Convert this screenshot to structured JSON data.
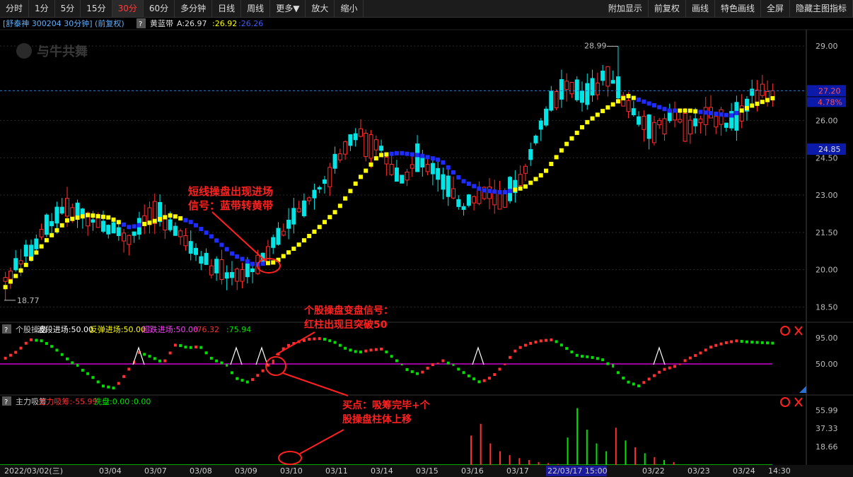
{
  "toolbar": {
    "left": [
      "分时",
      "1分",
      "5分",
      "15分",
      "30分",
      "60分",
      "多分钟",
      "日线",
      "周线",
      "更多▼",
      "放大",
      "缩小"
    ],
    "active": "30分",
    "right": [
      "附加显示",
      "前复权",
      "画线",
      "特色画线",
      "全屏",
      "隐藏主图指标"
    ]
  },
  "header": {
    "stock": "[舒泰神 300204 30分钟] (前复权)",
    "q": "?",
    "indicator": "黄蓝带",
    "a_label": "A:26.97",
    "v1": ":26.92",
    "v2": ":26.26"
  },
  "watermark": "与牛共舞",
  "colors": {
    "up": "#ff3030",
    "down": "#00e5e5",
    "yellow": "#ffff00",
    "blue": "#1e2cff",
    "grid": "#2a2a2a",
    "magenta": "#d000d0",
    "green": "#00e000",
    "annot": "#ff2020"
  },
  "price_axis": {
    "min": 18.0,
    "max": 29.6,
    "ticks": [
      "29.00",
      "26.00",
      "24.50",
      "23.00",
      "21.50",
      "20.00",
      "18.50"
    ]
  },
  "price_tags": {
    "last": "27.20",
    "pct": "4.78%",
    "ref": "24.85",
    "high": "28.99",
    "low": "18.77"
  },
  "chart_data": [
    {
      "type": "candlestick",
      "title": "舒泰神 300204 30分钟",
      "x_labels": [
        "2022/03/02(三)",
        "03/04",
        "03/07",
        "03/08",
        "03/09",
        "03/10",
        "03/11",
        "03/14",
        "03/15",
        "03/16",
        "03/17",
        "22/03/17 15:00",
        "03/22",
        "03/23",
        "03/24",
        "14:30"
      ],
      "ohlc_sampled": [
        [
          19.0,
          19.9,
          18.77,
          19.6
        ],
        [
          19.6,
          20.9,
          19.4,
          20.6
        ],
        [
          20.6,
          22.3,
          20.4,
          21.7
        ],
        [
          21.7,
          23.3,
          21.5,
          22.6
        ],
        [
          22.6,
          23.0,
          21.8,
          22.1
        ],
        [
          22.1,
          22.5,
          21.0,
          21.6
        ],
        [
          21.6,
          22.0,
          20.8,
          21.2
        ],
        [
          21.2,
          22.9,
          21.0,
          22.4
        ],
        [
          22.4,
          22.8,
          21.4,
          21.8
        ],
        [
          21.8,
          21.9,
          20.2,
          20.8
        ],
        [
          20.8,
          21.2,
          19.6,
          20.1
        ],
        [
          20.1,
          20.6,
          19.4,
          19.7
        ],
        [
          19.7,
          20.2,
          19.2,
          20.0
        ],
        [
          20.0,
          21.5,
          19.8,
          21.1
        ],
        [
          21.1,
          22.6,
          21.0,
          22.2
        ],
        [
          22.2,
          23.6,
          22.0,
          23.1
        ],
        [
          23.1,
          24.7,
          22.9,
          24.3
        ],
        [
          24.3,
          26.5,
          24.0,
          25.6
        ],
        [
          25.6,
          26.6,
          24.5,
          25.0
        ],
        [
          25.0,
          25.4,
          23.0,
          23.6
        ],
        [
          23.6,
          24.6,
          23.2,
          24.4
        ],
        [
          24.4,
          24.8,
          23.3,
          23.7
        ],
        [
          23.7,
          24.0,
          21.6,
          22.4
        ],
        [
          22.4,
          23.4,
          22.0,
          23.1
        ],
        [
          23.1,
          23.6,
          21.8,
          22.8
        ],
        [
          22.8,
          24.6,
          22.5,
          24.0
        ],
        [
          24.0,
          26.2,
          23.8,
          26.0
        ],
        [
          26.0,
          27.8,
          25.6,
          27.4
        ],
        [
          27.4,
          27.9,
          26.1,
          26.8
        ],
        [
          26.8,
          28.99,
          26.4,
          27.9
        ],
        [
          27.9,
          28.1,
          26.3,
          26.6
        ],
        [
          26.6,
          27.0,
          25.3,
          25.6
        ],
        [
          25.6,
          26.5,
          25.3,
          26.2
        ],
        [
          26.2,
          26.9,
          25.5,
          25.8
        ],
        [
          25.8,
          26.6,
          25.4,
          26.3
        ],
        [
          26.3,
          26.6,
          25.4,
          25.7
        ],
        [
          25.7,
          27.6,
          25.5,
          27.2
        ],
        [
          27.2,
          27.4,
          26.7,
          26.97
        ]
      ],
      "yellow_blue_band_sampled": [
        [
          19.3,
          "y"
        ],
        [
          20.2,
          "y"
        ],
        [
          21.2,
          "y"
        ],
        [
          22.0,
          "y"
        ],
        [
          22.2,
          "y"
        ],
        [
          22.1,
          "y"
        ],
        [
          21.7,
          "b"
        ],
        [
          21.9,
          "y"
        ],
        [
          22.2,
          "y"
        ],
        [
          21.9,
          "b"
        ],
        [
          21.3,
          "b"
        ],
        [
          20.6,
          "b"
        ],
        [
          20.2,
          "b"
        ],
        [
          20.3,
          "y"
        ],
        [
          20.9,
          "y"
        ],
        [
          21.6,
          "y"
        ],
        [
          22.4,
          "y"
        ],
        [
          23.6,
          "y"
        ],
        [
          24.6,
          "y"
        ],
        [
          24.7,
          "b"
        ],
        [
          24.6,
          "b"
        ],
        [
          24.4,
          "b"
        ],
        [
          23.6,
          "b"
        ],
        [
          23.2,
          "b"
        ],
        [
          23.1,
          "b"
        ],
        [
          23.3,
          "y"
        ],
        [
          23.9,
          "y"
        ],
        [
          25.0,
          "y"
        ],
        [
          25.9,
          "y"
        ],
        [
          26.5,
          "y"
        ],
        [
          27.0,
          "y"
        ],
        [
          26.7,
          "b"
        ],
        [
          26.4,
          "b"
        ],
        [
          26.4,
          "y"
        ],
        [
          26.3,
          "b"
        ],
        [
          26.2,
          "b"
        ],
        [
          26.6,
          "y"
        ],
        [
          26.9,
          "y"
        ]
      ]
    },
    {
      "type": "oscillator",
      "title": "个股操盘",
      "legend": [
        {
          "text": "个股操盘",
          "color": "#cccccc"
        },
        {
          "text": "波段进场:50.00",
          "color": "#ffffff"
        },
        {
          "text": "反弹进场:50.00",
          "color": "#ffff00"
        },
        {
          "text": "超跌进场:50.00",
          "color": "#ff40ff"
        },
        {
          "text": ":76.32",
          "color": "#ff3030"
        },
        {
          "text": ":75.94",
          "color": "#00e000"
        }
      ],
      "axis_ticks": [
        "95.00",
        "50.00"
      ],
      "ylim": [
        0,
        105
      ],
      "values_sampled": [
        60,
        72,
        92,
        90,
        78,
        60,
        44,
        30,
        12,
        8,
        36,
        70,
        62,
        52,
        84,
        78,
        80,
        58,
        50,
        25,
        18,
        35,
        58,
        80,
        88,
        93,
        94,
        88,
        76,
        70,
        74,
        76,
        58,
        40,
        32,
        48,
        56,
        44,
        30,
        18,
        28,
        50,
        76,
        85,
        90,
        92,
        78,
        64,
        62,
        58,
        42,
        20,
        12,
        26,
        40,
        46,
        58,
        68,
        80,
        86,
        90,
        88,
        87,
        86
      ]
    },
    {
      "type": "bar",
      "title": "主力吸筹",
      "legend": [
        {
          "text": "主力吸筹",
          "color": "#cccccc"
        },
        {
          "text": "主力吸筹:-55.99",
          "color": "#ff3030"
        },
        {
          "text": "洗盘:0.00",
          "color": "#00e000"
        },
        {
          "text": ":0.00",
          "color": "#00e000"
        }
      ],
      "axis_ticks": [
        "55.99",
        "37.33",
        "18.66"
      ],
      "ylim": [
        0,
        62
      ],
      "values_sampled": [
        0,
        0,
        0,
        0,
        0,
        0,
        0,
        0,
        0,
        0,
        0,
        0,
        0,
        0,
        0,
        0,
        0,
        0,
        0,
        0,
        0,
        0,
        0,
        0,
        0,
        0,
        0,
        0,
        0,
        0,
        0,
        0,
        0,
        0,
        0,
        0,
        0,
        0,
        0,
        0,
        0,
        0,
        0,
        0,
        0,
        0,
        0,
        0,
        30,
        42,
        22,
        14,
        10,
        7,
        5,
        3,
        2,
        1,
        28,
        58,
        36,
        22,
        14,
        38,
        25,
        18,
        12,
        8,
        5,
        3,
        0,
        0,
        0,
        0,
        0,
        0,
        0,
        0,
        0,
        0
      ]
    }
  ],
  "annotations": {
    "a1": [
      "短线操盘出现进场",
      "信号：蓝带转黄带"
    ],
    "a2": [
      "个股操盘变盘信号：",
      "红柱出现且突破50"
    ],
    "a3": [
      "买点：吸筹完毕+个",
      "股操盘柱体上移"
    ]
  },
  "bottom_bar": {
    "highlight": "22/03/17 15:00"
  }
}
